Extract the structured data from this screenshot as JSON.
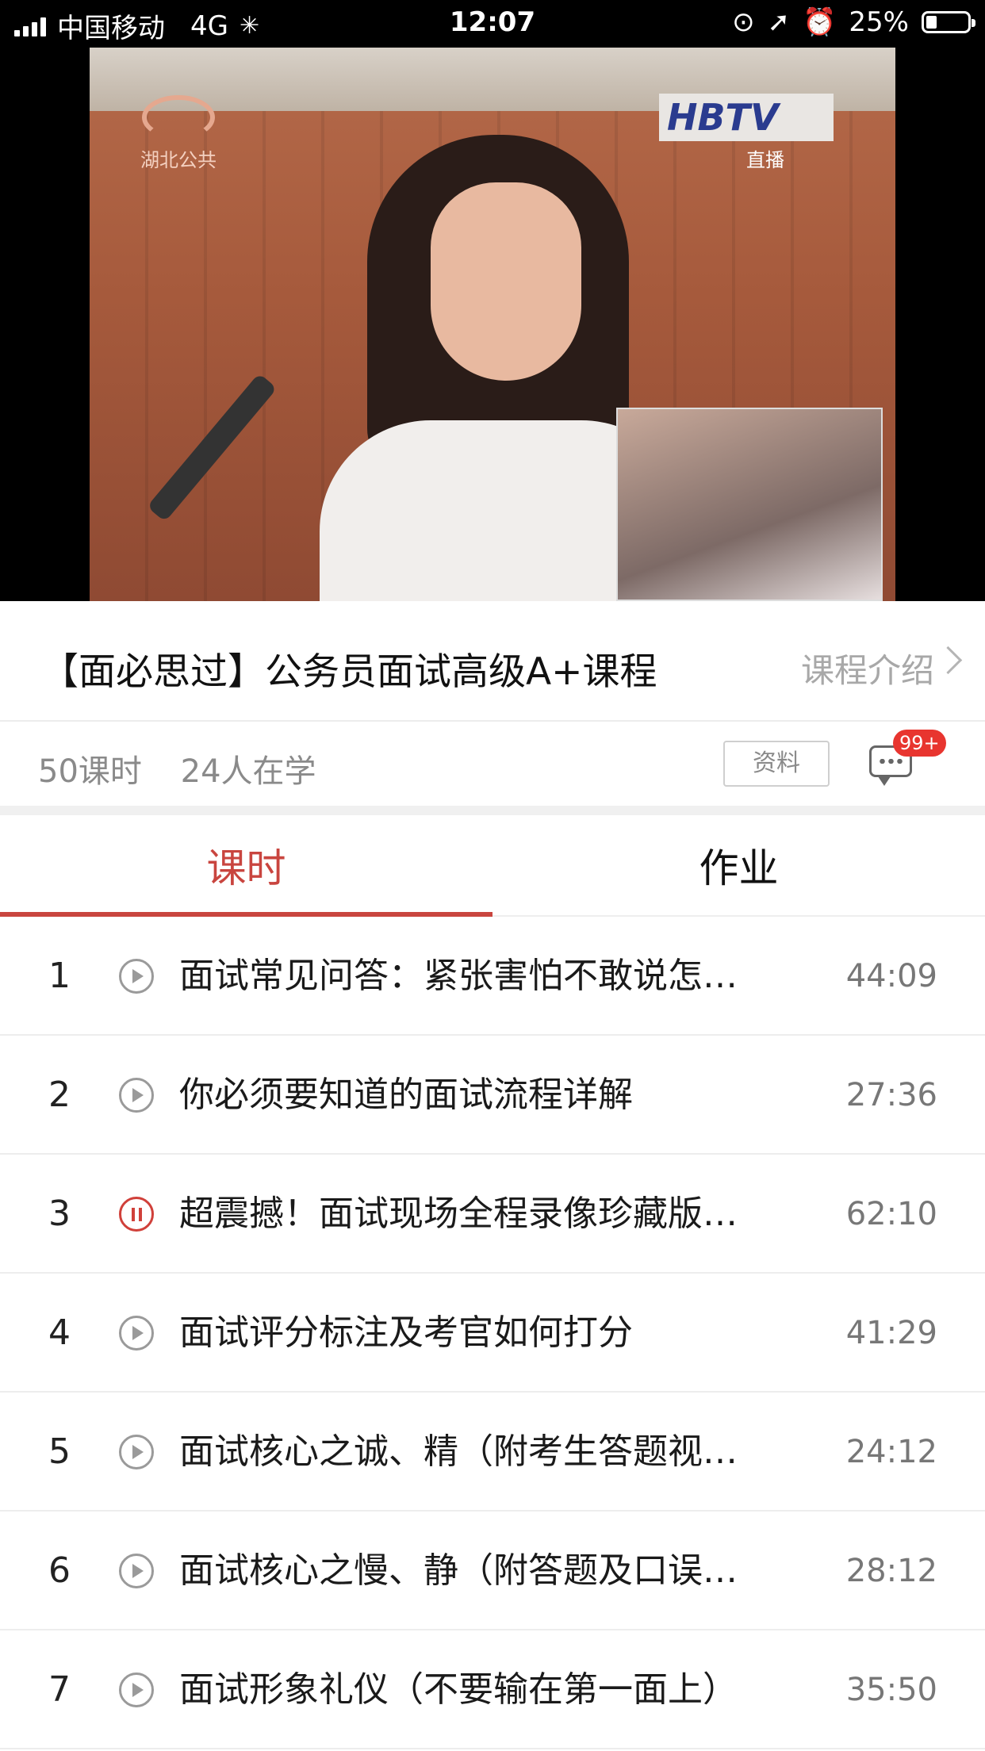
{
  "status_bar": {
    "carrier": "中国移动",
    "network": "4G",
    "time": "12:07",
    "battery": "25%",
    "battery_level": 0.25
  },
  "video": {
    "station_logo": "湖北公共",
    "broadcast_logo": "HBTV",
    "live_label": "直播"
  },
  "course": {
    "title": "【面必思过】公务员面试高级A+课程",
    "intro_link": "课程介绍",
    "lesson_count": "50课时",
    "learners": "24人在学",
    "materials_button": "资料",
    "comment_badge": "99+"
  },
  "tabs": [
    {
      "label": "课时",
      "active": true
    },
    {
      "label": "作业",
      "active": false
    }
  ],
  "accent_color": "#c9453f",
  "lessons": [
    {
      "num": "1",
      "title": "面试常见问答：紧张害怕不敢说怎…",
      "duration": "44:09",
      "state": "play"
    },
    {
      "num": "2",
      "title": "你必须要知道的面试流程详解",
      "duration": "27:36",
      "state": "play"
    },
    {
      "num": "3",
      "title": "超震撼！面试现场全程录像珍藏版…",
      "duration": "62:10",
      "state": "playing"
    },
    {
      "num": "4",
      "title": "面试评分标注及考官如何打分",
      "duration": "41:29",
      "state": "play"
    },
    {
      "num": "5",
      "title": "面试核心之诚、精（附考生答题视…",
      "duration": "24:12",
      "state": "play"
    },
    {
      "num": "6",
      "title": "面试核心之慢、静（附答题及口误…",
      "duration": "28:12",
      "state": "play"
    },
    {
      "num": "7",
      "title": "面试形象礼仪（不要输在第一面上）",
      "duration": "35:50",
      "state": "play"
    }
  ]
}
